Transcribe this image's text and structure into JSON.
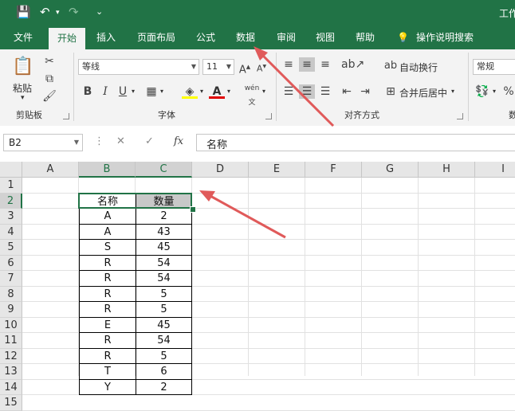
{
  "window": {
    "title": "工作"
  },
  "quick_access": {
    "save": "💾",
    "undo": "↶",
    "redo": "↷",
    "customize": "⌄"
  },
  "tabs": [
    "文件",
    "开始",
    "插入",
    "页面布局",
    "公式",
    "数据",
    "审阅",
    "视图",
    "帮助"
  ],
  "active_tab": "开始",
  "tell_me": "操作说明搜索",
  "ribbon": {
    "clipboard": {
      "paste": "粘贴",
      "label": "剪贴板"
    },
    "font": {
      "name": "等线",
      "size": "11",
      "bold": "B",
      "italic": "I",
      "underline": "U",
      "label": "字体",
      "phonetic": "wén"
    },
    "alignment": {
      "wrap": "自动换行",
      "merge": "合并后居中",
      "label": "对齐方式"
    },
    "number": {
      "format": "常规",
      "label": "数",
      "percent": "%"
    }
  },
  "formula_bar": {
    "name_box": "B2",
    "content": "名称",
    "fx": "fx"
  },
  "columns": [
    "A",
    "B",
    "C",
    "D",
    "E",
    "F",
    "G",
    "H",
    "I"
  ],
  "rows": [
    "1",
    "2",
    "3",
    "4",
    "5",
    "6",
    "7",
    "8",
    "9",
    "10",
    "11",
    "12",
    "13",
    "14",
    "15"
  ],
  "table": {
    "headers": [
      "名称",
      "数量"
    ],
    "rows": [
      [
        "A",
        "2"
      ],
      [
        "A",
        "43"
      ],
      [
        "S",
        "45"
      ],
      [
        "R",
        "54"
      ],
      [
        "R",
        "54"
      ],
      [
        "R",
        "5"
      ],
      [
        "R",
        "5"
      ],
      [
        "E",
        "45"
      ],
      [
        "R",
        "54"
      ],
      [
        "R",
        "5"
      ],
      [
        "T",
        "6"
      ],
      [
        "Y",
        "2"
      ]
    ]
  },
  "colors": {
    "brand": "#217346",
    "annotation_arrow": "#e05a5a",
    "header_fill": "#c8c8c8"
  }
}
